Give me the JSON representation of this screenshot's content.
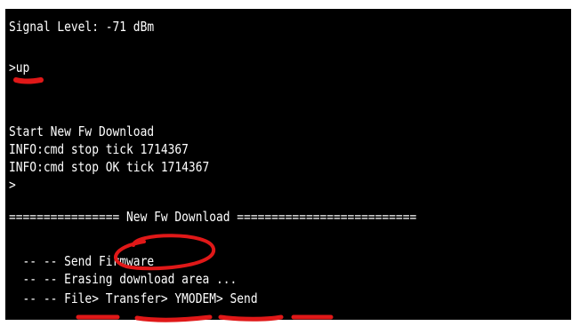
{
  "terminal": {
    "signal_line": "Signal Level: -71 dBm",
    "prompt_up": ">up",
    "start_line": "Start New Fw Download",
    "info_stop_tick": "INFO:cmd stop tick 1714367",
    "info_stop_ok": "INFO:cmd stop OK tick 1714367",
    "prompt_empty": ">",
    "separator": "================ New Fw Download ==========================",
    "send_firmware": "  -- -- Send Firmware",
    "erasing": "  -- -- Erasing download area ...",
    "menu_path": "  -- -- File> Transfer> YMODEM> Send"
  },
  "annotations": {
    "color": "#e01818",
    "marks": [
      "underline-up",
      "circle-firmware",
      "underline-file",
      "underline-transfer",
      "underline-ymodem",
      "underline-send"
    ]
  }
}
